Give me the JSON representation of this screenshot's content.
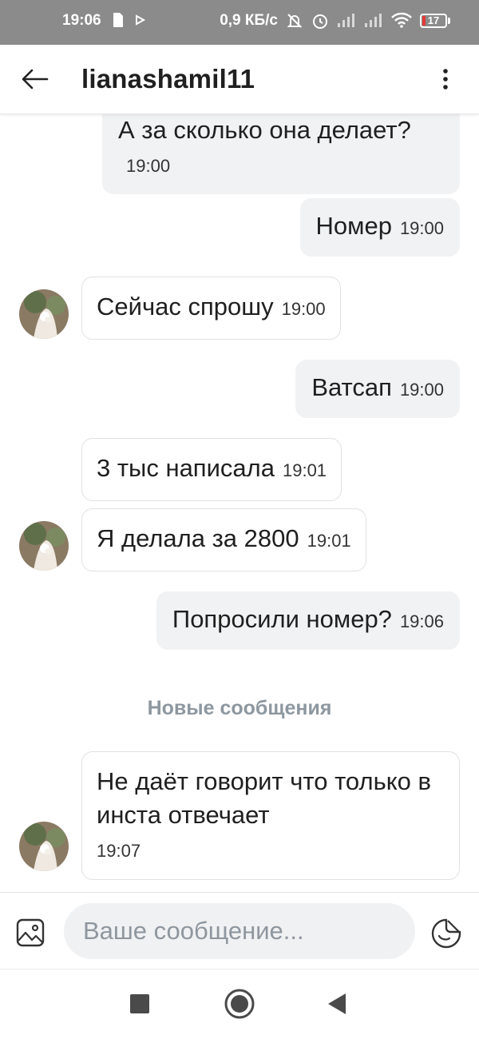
{
  "status_bar": {
    "time": "19:06",
    "network_speed": "0,9 КБ/с",
    "battery_level": "17",
    "icons": [
      "sim-icon",
      "play-icon",
      "mute-icon",
      "alarm-icon",
      "signal-icon",
      "signal-icon",
      "wifi-icon",
      "battery-icon"
    ]
  },
  "header": {
    "title": "lianashamil11",
    "back_icon": "arrow-left-icon",
    "menu_icon": "more-vertical-icon"
  },
  "messages": [
    {
      "direction": "out",
      "text": "А за сколько она делает?",
      "time": "19:00"
    },
    {
      "direction": "out",
      "text": "Номер",
      "time": "19:00"
    },
    {
      "direction": "in",
      "text": "Сейчас спрошу",
      "time": "19:00"
    },
    {
      "direction": "out",
      "text": "Ватсап",
      "time": "19:00"
    },
    {
      "direction": "in",
      "text": "3 тыс написала",
      "time": "19:01"
    },
    {
      "direction": "in",
      "text": "Я делала за 2800",
      "time": "19:01"
    },
    {
      "direction": "out",
      "text": "Попросили номер?",
      "time": "19:06"
    },
    {
      "direction": "in",
      "text": "Не даёт говорит что только в инста отвечает",
      "time": "19:07"
    }
  ],
  "separator": {
    "label": "Новые сообщения"
  },
  "composer": {
    "placeholder": "Ваше сообщение...",
    "attach_icon": "image-icon",
    "sticker_icon": "sticker-icon"
  },
  "colors": {
    "status_bar_bg": "#8b8b8b",
    "outgoing_bubble": "#f1f2f4",
    "incoming_border": "#dfe1e4",
    "separator_text": "#8d979f",
    "battery_low": "#e53935"
  }
}
